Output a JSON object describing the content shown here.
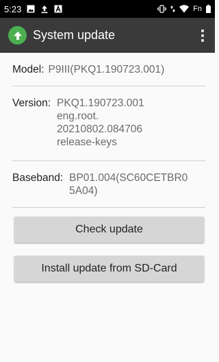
{
  "status_bar": {
    "time": "5:23",
    "left_icons": [
      "image-icon",
      "upload-icon",
      "a-icon"
    ],
    "right_icons": [
      "vibrate-icon",
      "data-arrows-icon",
      "wifi-icon"
    ],
    "carrier_text": "Fn",
    "battery_icon": "battery-icon"
  },
  "app_bar": {
    "title": "System update",
    "app_icon": "up-arrow-circle-icon",
    "menu_icon": "overflow-menu-icon"
  },
  "info": {
    "model": {
      "label": "Model:",
      "value": "P9III(PKQ1.190723.001)"
    },
    "version": {
      "label": "Version:",
      "value_lines": [
        "PKQ1.190723.001",
        "eng.root.",
        "20210802.084706",
        "release-keys"
      ]
    },
    "baseband": {
      "label": "Baseband:",
      "value_lines": [
        "BP01.004(SC60CETBR0",
        "5A04)"
      ]
    }
  },
  "buttons": {
    "check_update": "Check update",
    "install_sd": "Install update from SD-Card"
  },
  "colors": {
    "app_bar": "#3a3a3a",
    "accent_icon": "#4caf50",
    "button": "#d6d6d6"
  }
}
